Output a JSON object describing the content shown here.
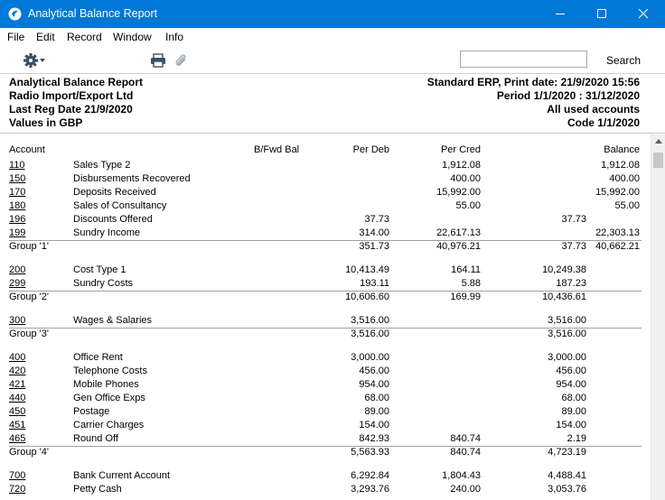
{
  "window": {
    "title": "Analytical Balance Report"
  },
  "menu": [
    "File",
    "Edit",
    "Record",
    "Window",
    "Info"
  ],
  "toolbar": {
    "search_value": "",
    "search_label": "Search"
  },
  "header": {
    "left": [
      "Analytical Balance Report",
      "Radio Import/Export Ltd",
      "Last Reg Date  21/9/2020",
      "Values in GBP"
    ],
    "right": [
      "Standard ERP, Print date: 21/9/2020 15:56",
      "Period   1/1/2020 : 31/12/2020",
      "All used accounts",
      "Code 1/1/2020"
    ]
  },
  "columns": {
    "account": "Account",
    "bfwd": "B/Fwd Bal",
    "deb": "Per Deb",
    "cred": "Per Cred",
    "balance": "Balance"
  },
  "rows": [
    {
      "acc": "110",
      "desc": "Sales Type 2",
      "deb": "",
      "cred": "1,912.08",
      "c4": "",
      "bal": "1,912.08"
    },
    {
      "acc": "150",
      "desc": "Disbursements Recovered",
      "deb": "",
      "cred": "400.00",
      "c4": "",
      "bal": "400.00"
    },
    {
      "acc": "170",
      "desc": "Deposits Received",
      "deb": "",
      "cred": "15,992.00",
      "c4": "",
      "bal": "15,992.00"
    },
    {
      "acc": "180",
      "desc": "Sales of Consultancy",
      "deb": "",
      "cred": "55.00",
      "c4": "",
      "bal": "55.00"
    },
    {
      "acc": "196",
      "desc": "Discounts Offered",
      "deb": "37.73",
      "cred": "",
      "c4": "37.73",
      "bal": ""
    },
    {
      "acc": "199",
      "desc": "Sundry Income",
      "deb": "314.00",
      "cred": "22,617.13",
      "c4": "",
      "bal": "22,303.13"
    },
    {
      "group": "Group '1'",
      "deb": "351.73",
      "cred": "40,976.21",
      "c4": "37.73",
      "bal": "40,662.21"
    },
    {
      "acc": "200",
      "desc": "Cost Type 1",
      "deb": "10,413.49",
      "cred": "164.11",
      "c4": "10,249.38",
      "bal": ""
    },
    {
      "acc": "299",
      "desc": "Sundry Costs",
      "deb": "193.11",
      "cred": "5.88",
      "c4": "187.23",
      "bal": ""
    },
    {
      "group": "Group '2'",
      "deb": "10,606.60",
      "cred": "169.99",
      "c4": "10,436.61",
      "bal": ""
    },
    {
      "acc": "300",
      "desc": "Wages & Salaries",
      "deb": "3,516.00",
      "cred": "",
      "c4": "3,516.00",
      "bal": ""
    },
    {
      "group": "Group '3'",
      "deb": "3,516.00",
      "cred": "",
      "c4": "3,516.00",
      "bal": ""
    },
    {
      "acc": "400",
      "desc": "Office Rent",
      "deb": "3,000.00",
      "cred": "",
      "c4": "3,000.00",
      "bal": ""
    },
    {
      "acc": "420",
      "desc": "Telephone Costs",
      "deb": "456.00",
      "cred": "",
      "c4": "456.00",
      "bal": ""
    },
    {
      "acc": "421",
      "desc": "Mobile Phones",
      "deb": "954.00",
      "cred": "",
      "c4": "954.00",
      "bal": ""
    },
    {
      "acc": "440",
      "desc": "Gen Office Exps",
      "deb": "68.00",
      "cred": "",
      "c4": "68.00",
      "bal": ""
    },
    {
      "acc": "450",
      "desc": "Postage",
      "deb": "89.00",
      "cred": "",
      "c4": "89.00",
      "bal": ""
    },
    {
      "acc": "451",
      "desc": "Carrier Charges",
      "deb": "154.00",
      "cred": "",
      "c4": "154.00",
      "bal": ""
    },
    {
      "acc": "465",
      "desc": "Round Off",
      "deb": "842.93",
      "cred": "840.74",
      "c4": "2.19",
      "bal": ""
    },
    {
      "group": "Group '4'",
      "deb": "5,563.93",
      "cred": "840.74",
      "c4": "4,723.19",
      "bal": ""
    },
    {
      "acc": "700",
      "desc": "Bank Current Account",
      "deb": "6,292.84",
      "cred": "1,804.43",
      "c4": "4,488.41",
      "bal": ""
    },
    {
      "acc": "720",
      "desc": "Petty Cash",
      "deb": "3,293.76",
      "cred": "240.00",
      "c4": "3,053.76",
      "bal": ""
    }
  ]
}
